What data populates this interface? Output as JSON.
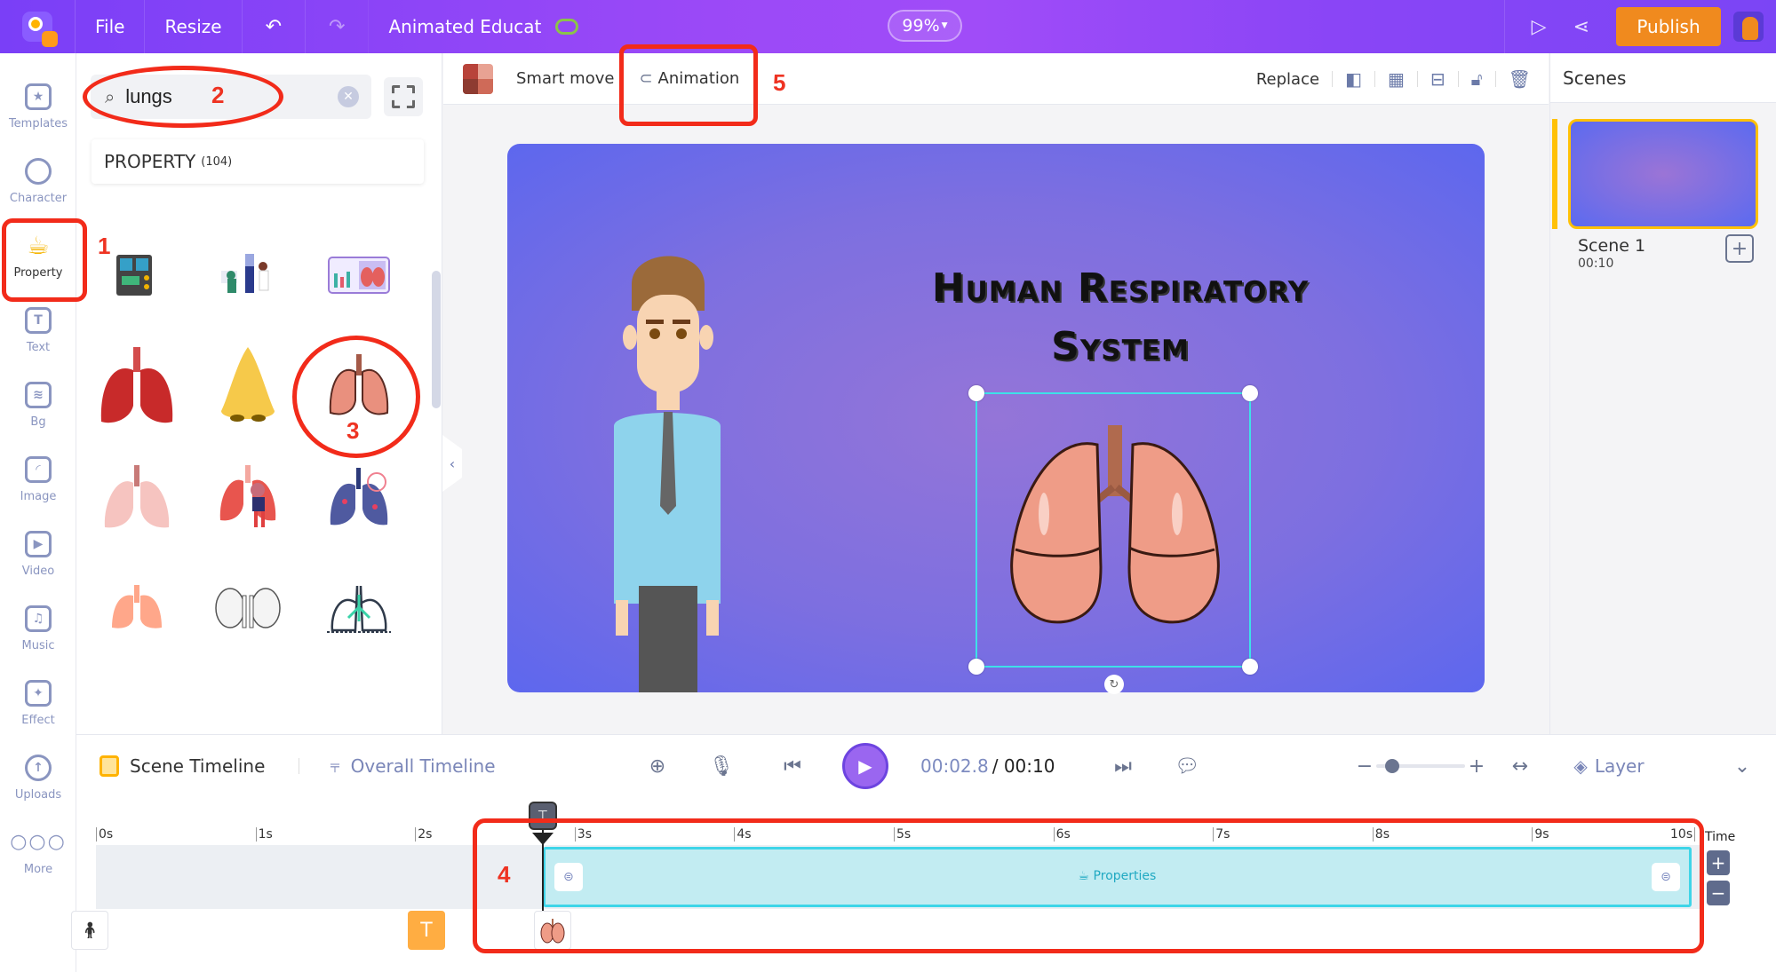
{
  "topbar": {
    "menu_file": "File",
    "menu_resize": "Resize",
    "undo_icon": "↶",
    "redo_icon": "↷",
    "doc_title": "Animated Educat",
    "zoom_level": "99%",
    "publish_label": "Publish",
    "colors": {
      "publish": "#f08a1e",
      "bar_start": "#7a3ff7",
      "bar_mid": "#a04cf8"
    }
  },
  "rail": {
    "items": [
      {
        "label": "Templates",
        "icon": "clapperboard-icon"
      },
      {
        "label": "Character",
        "icon": "person-icon"
      },
      {
        "label": "Property",
        "icon": "cup-icon",
        "active": true
      },
      {
        "label": "Text",
        "icon": "text-icon"
      },
      {
        "label": "Bg",
        "icon": "layers-icon"
      },
      {
        "label": "Image",
        "icon": "image-icon"
      },
      {
        "label": "Video",
        "icon": "video-icon"
      },
      {
        "label": "Music",
        "icon": "music-icon"
      },
      {
        "label": "Effect",
        "icon": "sparkle-icon"
      },
      {
        "label": "Uploads",
        "icon": "cloud-upload-icon"
      },
      {
        "label": "More",
        "icon": "more-dots-icon"
      }
    ]
  },
  "panel": {
    "search_value": "lungs",
    "category_label": "PROPERTY",
    "category_count": "(104)",
    "results": [
      "ventilator-machine",
      "doctor-xray-scene",
      "lung-report-screen",
      "red-lungs",
      "yellow-nose",
      "realistic-lungs",
      "pink-lungs",
      "lungs-with-person",
      "blue-lungs-infection",
      "orange-lungs-simple",
      "sketch-kidneys",
      "line-art-lungs"
    ]
  },
  "toolbar": {
    "smart_move": "Smart move",
    "animation": "Animation",
    "replace": "Replace"
  },
  "stage": {
    "title_line1": "Human Respiratory",
    "title_line2": "System"
  },
  "scenes": {
    "header": "Scenes",
    "items": [
      {
        "name": "Scene 1",
        "duration": "00:10"
      }
    ],
    "add_icon": "+"
  },
  "timeline": {
    "scene_tab": "Scene Timeline",
    "overall_tab": "Overall Timeline",
    "current_time": "00:02.8",
    "total_time": "/ 00:10",
    "layer_label": "Layer",
    "ticks": [
      "0s",
      "1s",
      "2s",
      "3s",
      "4s",
      "5s",
      "6s",
      "7s",
      "8s",
      "9s",
      "10s"
    ],
    "clip_label": "Properties",
    "time_label": "Time",
    "playhead_seconds": 2.8,
    "duration_seconds": 10,
    "clip_start_seconds": 2.8,
    "clip_end_seconds": 10,
    "zoom_slider_fraction": 0.1
  },
  "annotations": [
    "1",
    "2",
    "3",
    "4",
    "5"
  ]
}
